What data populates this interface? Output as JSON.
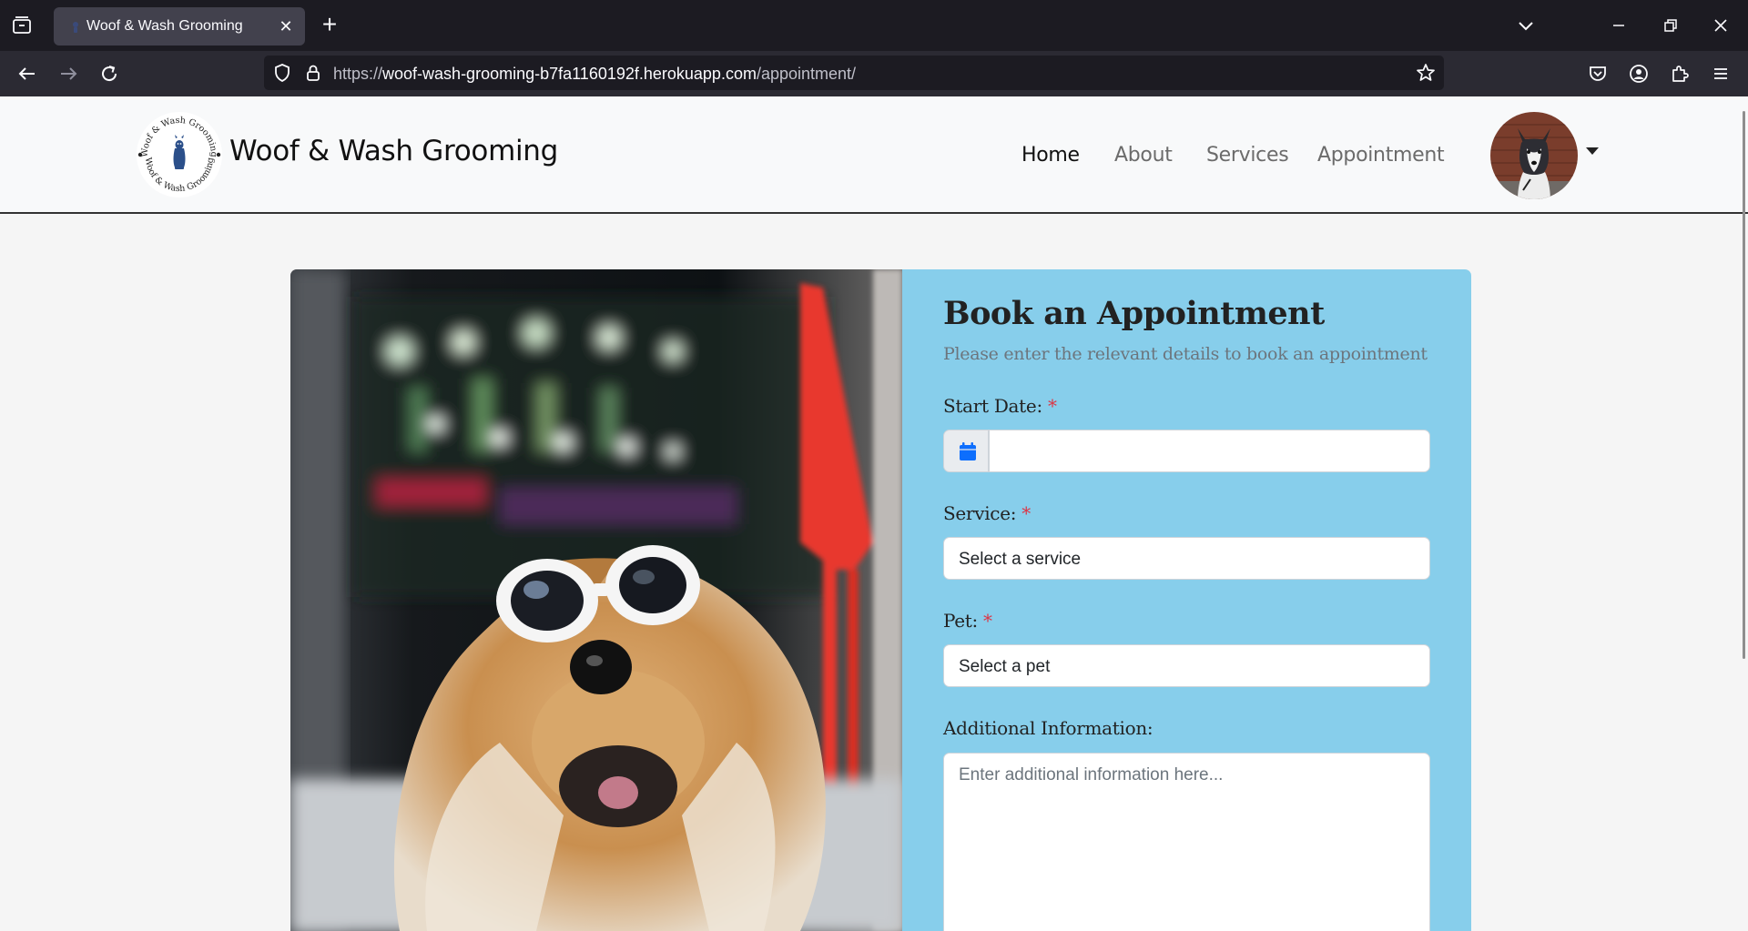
{
  "browser": {
    "tab_title": "Woof & Wash Grooming",
    "tab_close": "✕",
    "new_tab": "+",
    "url_prefix": "https://",
    "url_domain": "woof-wash-grooming-b7fa1160192f.herokuapp.com",
    "url_path": "/appointment/"
  },
  "header": {
    "brand": "Woof & Wash Grooming",
    "logo_text": "Woof & Wash Grooming",
    "nav": {
      "home": "Home",
      "about": "About",
      "services": "Services",
      "appointment": "Appointment"
    }
  },
  "form": {
    "title": "Book an Appointment",
    "subtitle": "Please enter the relevant details to book an appointment",
    "start_date_label": "Start Date:",
    "service_label": "Service:",
    "service_value": "Select a service",
    "pet_label": "Pet:",
    "pet_value": "Select a pet",
    "info_label": "Additional Information:",
    "info_placeholder": "Enter additional information here...",
    "required_mark": "*"
  },
  "colors": {
    "form_panel": "#87ceeb",
    "required": "#dc3545",
    "calendar_icon": "#0d6efd"
  }
}
